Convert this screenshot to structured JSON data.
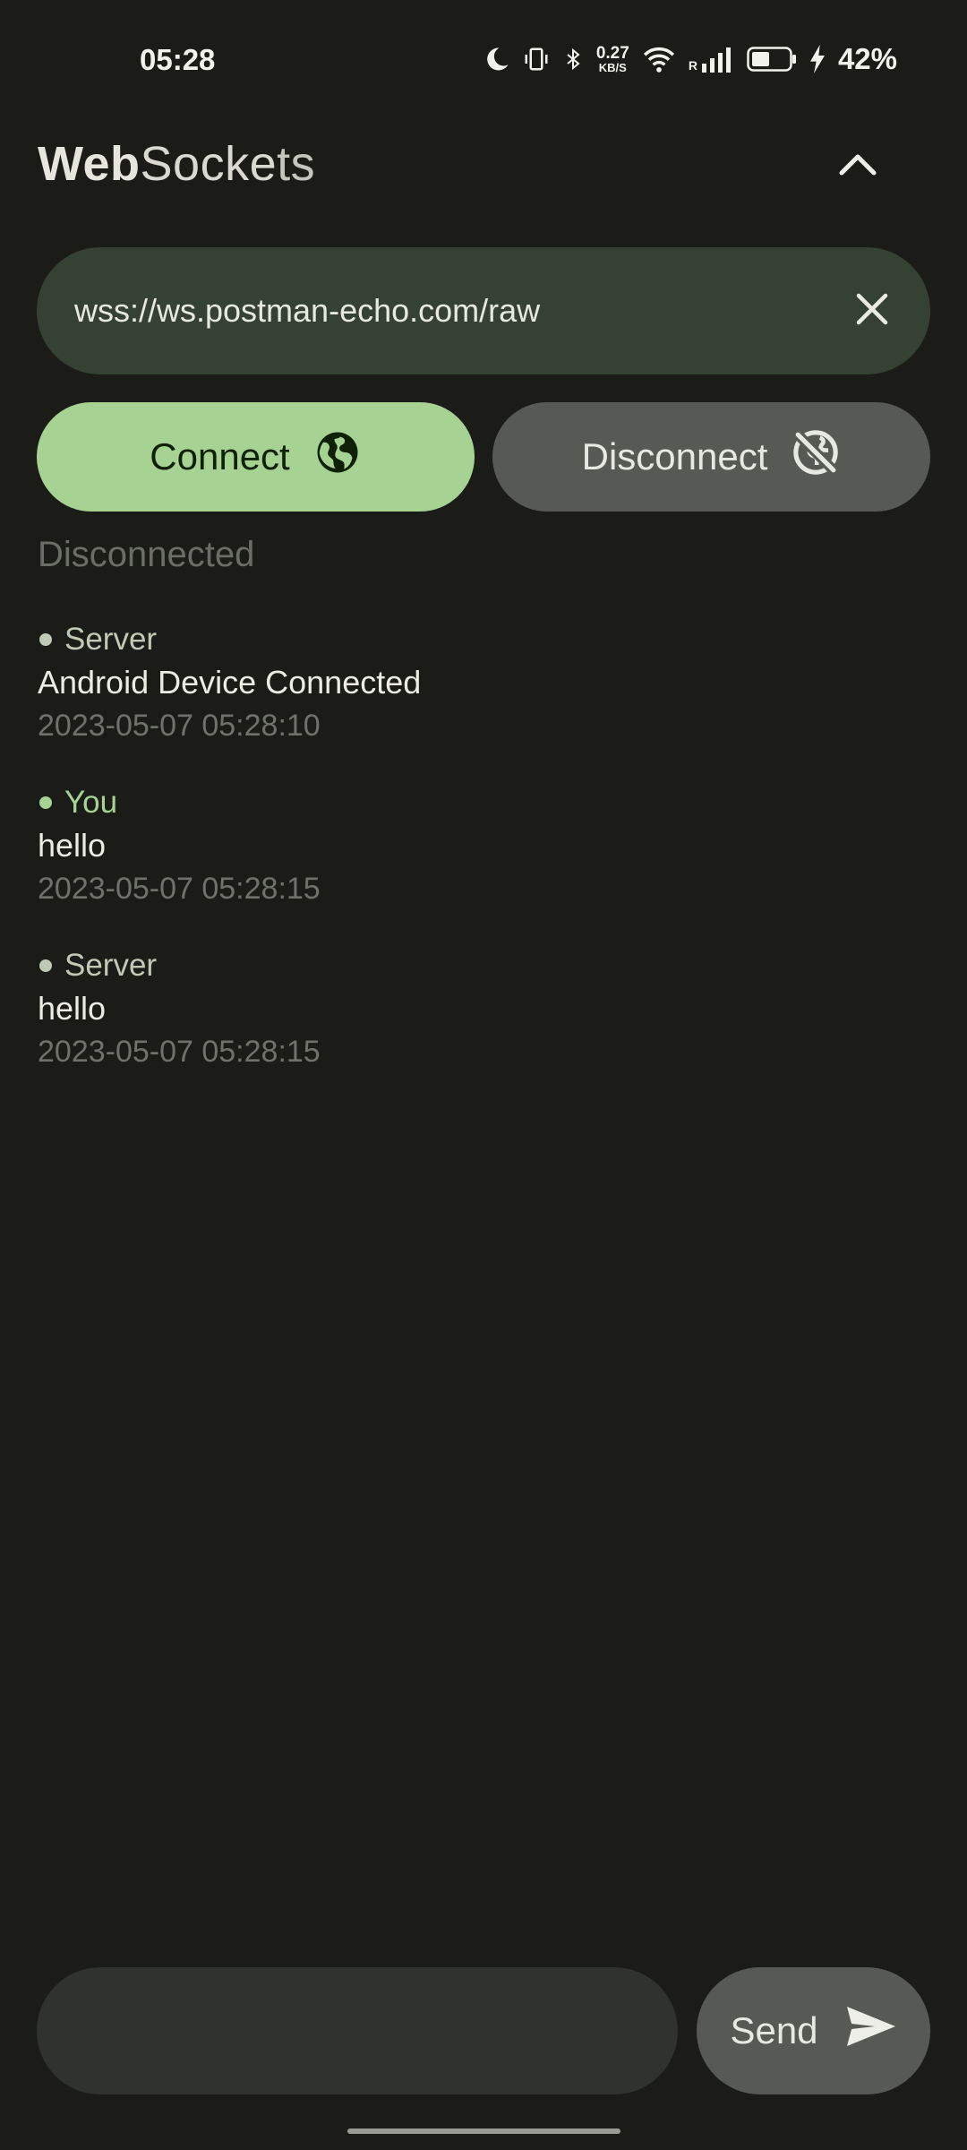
{
  "status_bar": {
    "time": "05:28",
    "net_speed_value": "0.27",
    "net_speed_unit": "KB/S",
    "signal_label": "R",
    "battery_percent": "42%",
    "icons": [
      "moon-icon",
      "vibrate-icon",
      "bluetooth-icon",
      "wifi-icon",
      "cell-signal-icon",
      "battery-icon",
      "charging-icon"
    ]
  },
  "header": {
    "title_part1": "Web",
    "title_part2": "Socke",
    "title_part3": "ts",
    "collapse_icon": "chevron-up-icon"
  },
  "url_field": {
    "value": "wss://ws.postman-echo.com/raw",
    "clear_icon": "close-icon"
  },
  "actions": {
    "connect_label": "Connect",
    "connect_icon": "globe-icon",
    "disconnect_label": "Disconnect",
    "disconnect_icon": "globe-off-icon"
  },
  "connection_status": "Disconnected",
  "messages": [
    {
      "sender": "Server",
      "text": "Android Device Connected",
      "time": "2023-05-07 05:28:10"
    },
    {
      "sender": "You",
      "text": "hello",
      "time": "2023-05-07 05:28:15"
    },
    {
      "sender": "Server",
      "text": "hello",
      "time": "2023-05-07 05:28:15"
    }
  ],
  "composer": {
    "input_value": "",
    "send_label": "Send",
    "send_icon": "send-icon"
  },
  "colors": {
    "background": "#1b1c18",
    "accent": "#a6d394",
    "url_field_bg": "#354133",
    "secondary_button": "#575a54"
  }
}
